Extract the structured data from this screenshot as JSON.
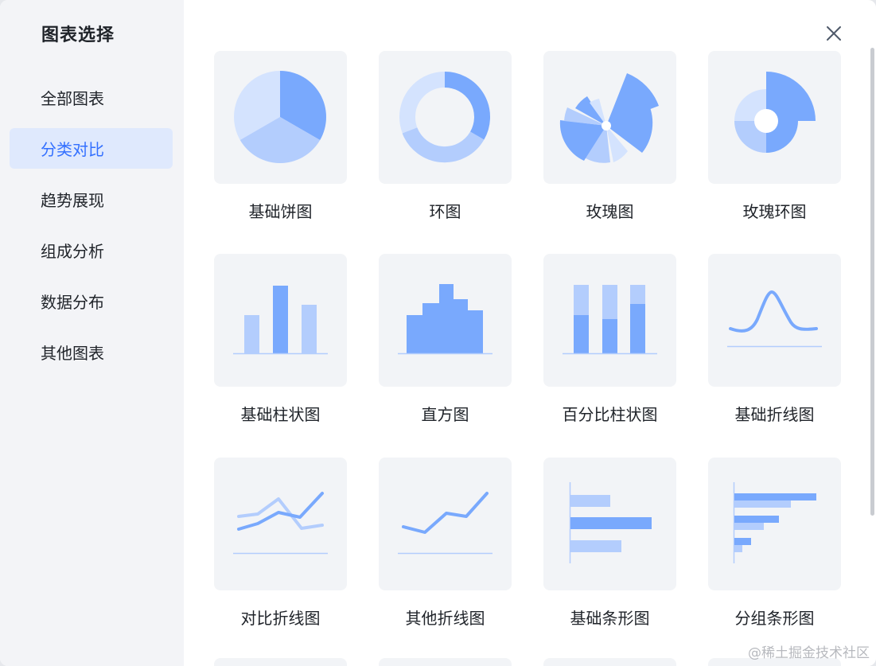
{
  "sidebar": {
    "title": "图表选择",
    "items": [
      {
        "label": "全部图表",
        "active": false
      },
      {
        "label": "分类对比",
        "active": true
      },
      {
        "label": "趋势展现",
        "active": false
      },
      {
        "label": "组成分析",
        "active": false
      },
      {
        "label": "数据分布",
        "active": false
      },
      {
        "label": "其他图表",
        "active": false
      }
    ]
  },
  "charts": [
    {
      "label": "基础饼图",
      "icon": "pie-chart-icon"
    },
    {
      "label": "环图",
      "icon": "donut-chart-icon"
    },
    {
      "label": "玫瑰图",
      "icon": "rose-chart-icon"
    },
    {
      "label": "玫瑰环图",
      "icon": "rose-donut-chart-icon"
    },
    {
      "label": "基础柱状图",
      "icon": "bar-chart-icon"
    },
    {
      "label": "直方图",
      "icon": "histogram-icon"
    },
    {
      "label": "百分比柱状图",
      "icon": "percent-bar-chart-icon"
    },
    {
      "label": "基础折线图",
      "icon": "line-chart-icon"
    },
    {
      "label": "对比折线图",
      "icon": "compare-line-chart-icon"
    },
    {
      "label": "其他折线图",
      "icon": "other-line-chart-icon"
    },
    {
      "label": "基础条形图",
      "icon": "horizontal-bar-chart-icon"
    },
    {
      "label": "分组条形图",
      "icon": "grouped-horizontal-bar-chart-icon"
    }
  ],
  "colors": {
    "accent": "#3370ff",
    "chart_dark": "#79a9fd",
    "chart_mid": "#b3cdfd",
    "chart_light": "#d4e3fe",
    "active_bg": "#dfe9fd"
  },
  "close_icon": "close-icon",
  "watermark": "@稀土掘金技术社区"
}
